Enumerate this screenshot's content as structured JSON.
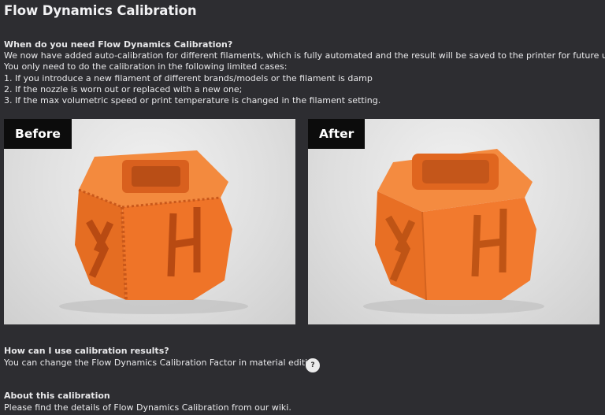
{
  "title": "Flow Dynamics Calibration",
  "intro": {
    "heading": "When do you need Flow Dynamics Calibration?",
    "lines": [
      "We now have added auto-calibration for different filaments, which is fully automated and the result will be saved to the printer for future use.",
      "You only need to do the calibration in the following limited cases:",
      "1. If you introduce a new filament of different brands/models or the filament is damp",
      "2. If the nozzle is worn out or replaced with a new one;",
      "3. If the max volumetric speed or print temperature is changed in the filament setting."
    ]
  },
  "images": {
    "before_label": "Before",
    "after_label": "After"
  },
  "usage": {
    "heading": "How can I use calibration results?",
    "text": "You can change the Flow Dynamics Calibration Factor in material editing",
    "help_icon": "question-mark",
    "help_symbol": "?"
  },
  "about": {
    "heading": "About this calibration",
    "text": "Please find the details of Flow Dynamics Calibration from our wiki."
  },
  "colors": {
    "background": "#2d2d31",
    "cube_orange": "#f07a2c"
  }
}
